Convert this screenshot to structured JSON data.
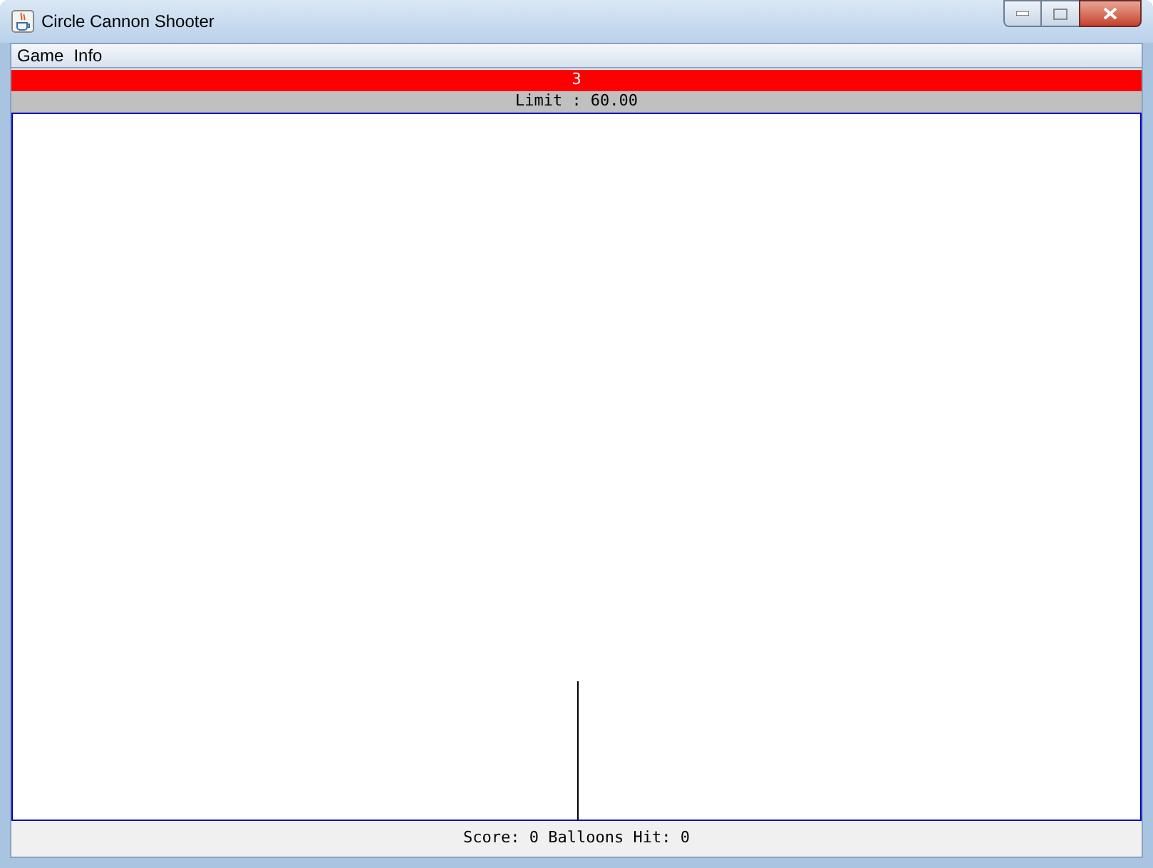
{
  "window": {
    "title": "Circle Cannon Shooter"
  },
  "menu": [
    {
      "label": "Game"
    },
    {
      "label": "Info"
    }
  ],
  "countdown": "3",
  "limit": "Limit : 60.00",
  "status_bar": "Score: 0 Balloons Hit: 0"
}
